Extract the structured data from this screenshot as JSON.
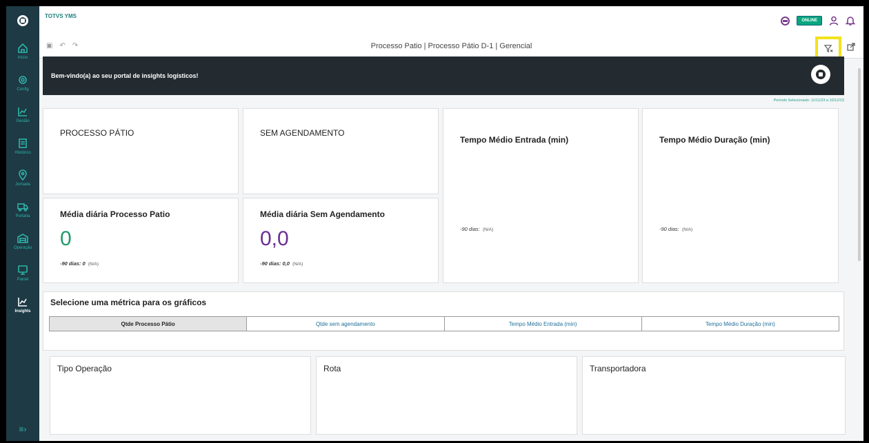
{
  "app": {
    "name": "TOTVS YMS",
    "status": "ONLINE"
  },
  "sidebar": {
    "items": [
      {
        "label": "Início",
        "icon": "home-icon"
      },
      {
        "label": "Config",
        "icon": "gear-icon"
      },
      {
        "label": "Gestão",
        "icon": "chart-icon"
      },
      {
        "label": "Histórico",
        "icon": "history-icon"
      },
      {
        "label": "Jornada",
        "icon": "location-icon"
      },
      {
        "label": "Portaria",
        "icon": "truck-icon"
      },
      {
        "label": "Operação",
        "icon": "warehouse-icon"
      },
      {
        "label": "Painel",
        "icon": "monitor-icon"
      },
      {
        "label": "Insights",
        "icon": "insights-icon"
      }
    ],
    "collapse_glyph": "≡›"
  },
  "subbar": {
    "breadcrumb": "Processo Patio | Processo Pátio D-1 | Gerencial"
  },
  "banner": {
    "text": "Bem-vindo(a) ao seu portal de insights logísticos!",
    "period": "Período Selecionado: 11/11/23 a 10/12/23"
  },
  "cards": {
    "processo_patio": {
      "title": "PROCESSO PÁTIO"
    },
    "sem_agendamento": {
      "title": "SEM AGENDAMENTO"
    },
    "tempo_entrada": {
      "title": "Tempo Médio Entrada (min)",
      "note": "-90 dias:",
      "na": "(N/A)"
    },
    "tempo_duracao": {
      "title": "Tempo Médio Duração (min)",
      "note": "-90 dias:",
      "na": "(N/A)"
    },
    "media_processo": {
      "title": "Média diária Processo Patio",
      "value": "0",
      "note": "-90 dias: 0",
      "na": "(N/A)",
      "color": "#1e9d6a"
    },
    "media_sem_agend": {
      "title": "Média diária Sem Agendamento",
      "value": "0,0",
      "note": "-90 dias: 0,0",
      "na": "(N/A)",
      "color": "#6b2e91"
    }
  },
  "metrics": {
    "title": "Selecione uma métrica para os gráficos",
    "tabs": [
      "Qtde Processo Pátio",
      "Qtde sem agendamento",
      "Tempo Médio Entrada (min)",
      "Tempo Médio Duração (min)"
    ],
    "selected": "Qtde Processo Pátio"
  },
  "panels": [
    "Tipo Operação",
    "Rota",
    "Transportadora"
  ],
  "colors": {
    "sidebar": "#1d3a45",
    "accent": "#2fb5a8",
    "highlight": "#f2e21a"
  }
}
